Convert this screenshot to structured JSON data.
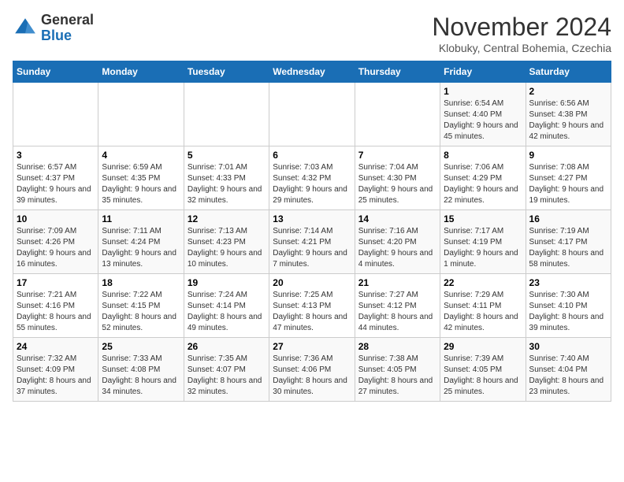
{
  "logo": {
    "general": "General",
    "blue": "Blue"
  },
  "title": "November 2024",
  "location": "Klobuky, Central Bohemia, Czechia",
  "days_of_week": [
    "Sunday",
    "Monday",
    "Tuesday",
    "Wednesday",
    "Thursday",
    "Friday",
    "Saturday"
  ],
  "weeks": [
    [
      {
        "day": "",
        "sunrise": "",
        "sunset": "",
        "daylight": ""
      },
      {
        "day": "",
        "sunrise": "",
        "sunset": "",
        "daylight": ""
      },
      {
        "day": "",
        "sunrise": "",
        "sunset": "",
        "daylight": ""
      },
      {
        "day": "",
        "sunrise": "",
        "sunset": "",
        "daylight": ""
      },
      {
        "day": "",
        "sunrise": "",
        "sunset": "",
        "daylight": ""
      },
      {
        "day": "1",
        "sunrise": "Sunrise: 6:54 AM",
        "sunset": "Sunset: 4:40 PM",
        "daylight": "Daylight: 9 hours and 45 minutes."
      },
      {
        "day": "2",
        "sunrise": "Sunrise: 6:56 AM",
        "sunset": "Sunset: 4:38 PM",
        "daylight": "Daylight: 9 hours and 42 minutes."
      }
    ],
    [
      {
        "day": "3",
        "sunrise": "Sunrise: 6:57 AM",
        "sunset": "Sunset: 4:37 PM",
        "daylight": "Daylight: 9 hours and 39 minutes."
      },
      {
        "day": "4",
        "sunrise": "Sunrise: 6:59 AM",
        "sunset": "Sunset: 4:35 PM",
        "daylight": "Daylight: 9 hours and 35 minutes."
      },
      {
        "day": "5",
        "sunrise": "Sunrise: 7:01 AM",
        "sunset": "Sunset: 4:33 PM",
        "daylight": "Daylight: 9 hours and 32 minutes."
      },
      {
        "day": "6",
        "sunrise": "Sunrise: 7:03 AM",
        "sunset": "Sunset: 4:32 PM",
        "daylight": "Daylight: 9 hours and 29 minutes."
      },
      {
        "day": "7",
        "sunrise": "Sunrise: 7:04 AM",
        "sunset": "Sunset: 4:30 PM",
        "daylight": "Daylight: 9 hours and 25 minutes."
      },
      {
        "day": "8",
        "sunrise": "Sunrise: 7:06 AM",
        "sunset": "Sunset: 4:29 PM",
        "daylight": "Daylight: 9 hours and 22 minutes."
      },
      {
        "day": "9",
        "sunrise": "Sunrise: 7:08 AM",
        "sunset": "Sunset: 4:27 PM",
        "daylight": "Daylight: 9 hours and 19 minutes."
      }
    ],
    [
      {
        "day": "10",
        "sunrise": "Sunrise: 7:09 AM",
        "sunset": "Sunset: 4:26 PM",
        "daylight": "Daylight: 9 hours and 16 minutes."
      },
      {
        "day": "11",
        "sunrise": "Sunrise: 7:11 AM",
        "sunset": "Sunset: 4:24 PM",
        "daylight": "Daylight: 9 hours and 13 minutes."
      },
      {
        "day": "12",
        "sunrise": "Sunrise: 7:13 AM",
        "sunset": "Sunset: 4:23 PM",
        "daylight": "Daylight: 9 hours and 10 minutes."
      },
      {
        "day": "13",
        "sunrise": "Sunrise: 7:14 AM",
        "sunset": "Sunset: 4:21 PM",
        "daylight": "Daylight: 9 hours and 7 minutes."
      },
      {
        "day": "14",
        "sunrise": "Sunrise: 7:16 AM",
        "sunset": "Sunset: 4:20 PM",
        "daylight": "Daylight: 9 hours and 4 minutes."
      },
      {
        "day": "15",
        "sunrise": "Sunrise: 7:17 AM",
        "sunset": "Sunset: 4:19 PM",
        "daylight": "Daylight: 9 hours and 1 minute."
      },
      {
        "day": "16",
        "sunrise": "Sunrise: 7:19 AM",
        "sunset": "Sunset: 4:17 PM",
        "daylight": "Daylight: 8 hours and 58 minutes."
      }
    ],
    [
      {
        "day": "17",
        "sunrise": "Sunrise: 7:21 AM",
        "sunset": "Sunset: 4:16 PM",
        "daylight": "Daylight: 8 hours and 55 minutes."
      },
      {
        "day": "18",
        "sunrise": "Sunrise: 7:22 AM",
        "sunset": "Sunset: 4:15 PM",
        "daylight": "Daylight: 8 hours and 52 minutes."
      },
      {
        "day": "19",
        "sunrise": "Sunrise: 7:24 AM",
        "sunset": "Sunset: 4:14 PM",
        "daylight": "Daylight: 8 hours and 49 minutes."
      },
      {
        "day": "20",
        "sunrise": "Sunrise: 7:25 AM",
        "sunset": "Sunset: 4:13 PM",
        "daylight": "Daylight: 8 hours and 47 minutes."
      },
      {
        "day": "21",
        "sunrise": "Sunrise: 7:27 AM",
        "sunset": "Sunset: 4:12 PM",
        "daylight": "Daylight: 8 hours and 44 minutes."
      },
      {
        "day": "22",
        "sunrise": "Sunrise: 7:29 AM",
        "sunset": "Sunset: 4:11 PM",
        "daylight": "Daylight: 8 hours and 42 minutes."
      },
      {
        "day": "23",
        "sunrise": "Sunrise: 7:30 AM",
        "sunset": "Sunset: 4:10 PM",
        "daylight": "Daylight: 8 hours and 39 minutes."
      }
    ],
    [
      {
        "day": "24",
        "sunrise": "Sunrise: 7:32 AM",
        "sunset": "Sunset: 4:09 PM",
        "daylight": "Daylight: 8 hours and 37 minutes."
      },
      {
        "day": "25",
        "sunrise": "Sunrise: 7:33 AM",
        "sunset": "Sunset: 4:08 PM",
        "daylight": "Daylight: 8 hours and 34 minutes."
      },
      {
        "day": "26",
        "sunrise": "Sunrise: 7:35 AM",
        "sunset": "Sunset: 4:07 PM",
        "daylight": "Daylight: 8 hours and 32 minutes."
      },
      {
        "day": "27",
        "sunrise": "Sunrise: 7:36 AM",
        "sunset": "Sunset: 4:06 PM",
        "daylight": "Daylight: 8 hours and 30 minutes."
      },
      {
        "day": "28",
        "sunrise": "Sunrise: 7:38 AM",
        "sunset": "Sunset: 4:05 PM",
        "daylight": "Daylight: 8 hours and 27 minutes."
      },
      {
        "day": "29",
        "sunrise": "Sunrise: 7:39 AM",
        "sunset": "Sunset: 4:05 PM",
        "daylight": "Daylight: 8 hours and 25 minutes."
      },
      {
        "day": "30",
        "sunrise": "Sunrise: 7:40 AM",
        "sunset": "Sunset: 4:04 PM",
        "daylight": "Daylight: 8 hours and 23 minutes."
      }
    ]
  ]
}
